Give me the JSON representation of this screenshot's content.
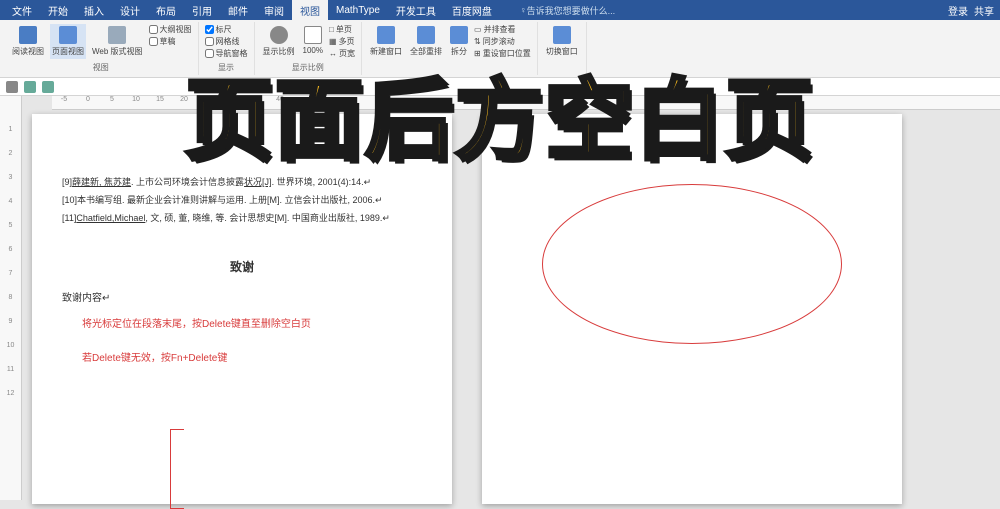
{
  "titlebar": {
    "login": "登录",
    "share": "共享"
  },
  "tabs": [
    "文件",
    "开始",
    "插入",
    "设计",
    "布局",
    "引用",
    "邮件",
    "审阅",
    "视图",
    "MathType",
    "开发工具",
    "百度网盘"
  ],
  "active_tab_index": 8,
  "tellme": "告诉我您想要做什么...",
  "ribbon": {
    "group1": {
      "label": "视图",
      "btns": [
        "阅读视图",
        "页面视图",
        "Web 版式视图"
      ],
      "checks": [
        "大纲视图",
        "草稿"
      ]
    },
    "group2": {
      "label": "显示",
      "checks1": [
        "标尺",
        "网格线",
        "导航窗格"
      ]
    },
    "group3": {
      "label": "显示比例",
      "btns": [
        "显示比例",
        "100%"
      ],
      "checks": [
        "单页",
        "多页",
        "页宽"
      ]
    },
    "group4": {
      "btns": [
        "新建窗口",
        "全部重排",
        "拆分"
      ],
      "checks": [
        "并排查看",
        "同步滚动",
        "重设窗口位置"
      ]
    },
    "group5": {
      "btns": [
        "切换窗口"
      ]
    }
  },
  "hruler": [
    "-5",
    "0",
    "5",
    "10",
    "15",
    "20",
    "25",
    "30",
    "35",
    "40"
  ],
  "vruler": [
    "1",
    "2",
    "3",
    "4",
    "5",
    "6",
    "7",
    "8",
    "9",
    "10",
    "11",
    "12"
  ],
  "document": {
    "refs": [
      {
        "idx": "[9]",
        "authors": "薛建新, 焦苏建",
        "text": ". 上市公司环境会计信息披露",
        "link": "状况[J]",
        "tail": ". 世界环境, 2001(4):14."
      },
      {
        "idx": "[10]",
        "text": "本书编写组. 最新企业会计准则讲解与运用. 上册[M]. 立信会计出版社, 2006."
      },
      {
        "idx": "[11]",
        "link": "Chatfield,Michael",
        "text": ", 文, 硕, 董, 晓维, 等. 会计思想史[M]. 中国商业出版社, 1989."
      }
    ],
    "heading": "致谢",
    "subheading": "致谢内容",
    "note1": "将光标定位在段落末尾，按Delete键直至删除空白页",
    "note2": "若Delete键无效，按Fn+Delete键"
  },
  "overlay": "页面后方空白页"
}
